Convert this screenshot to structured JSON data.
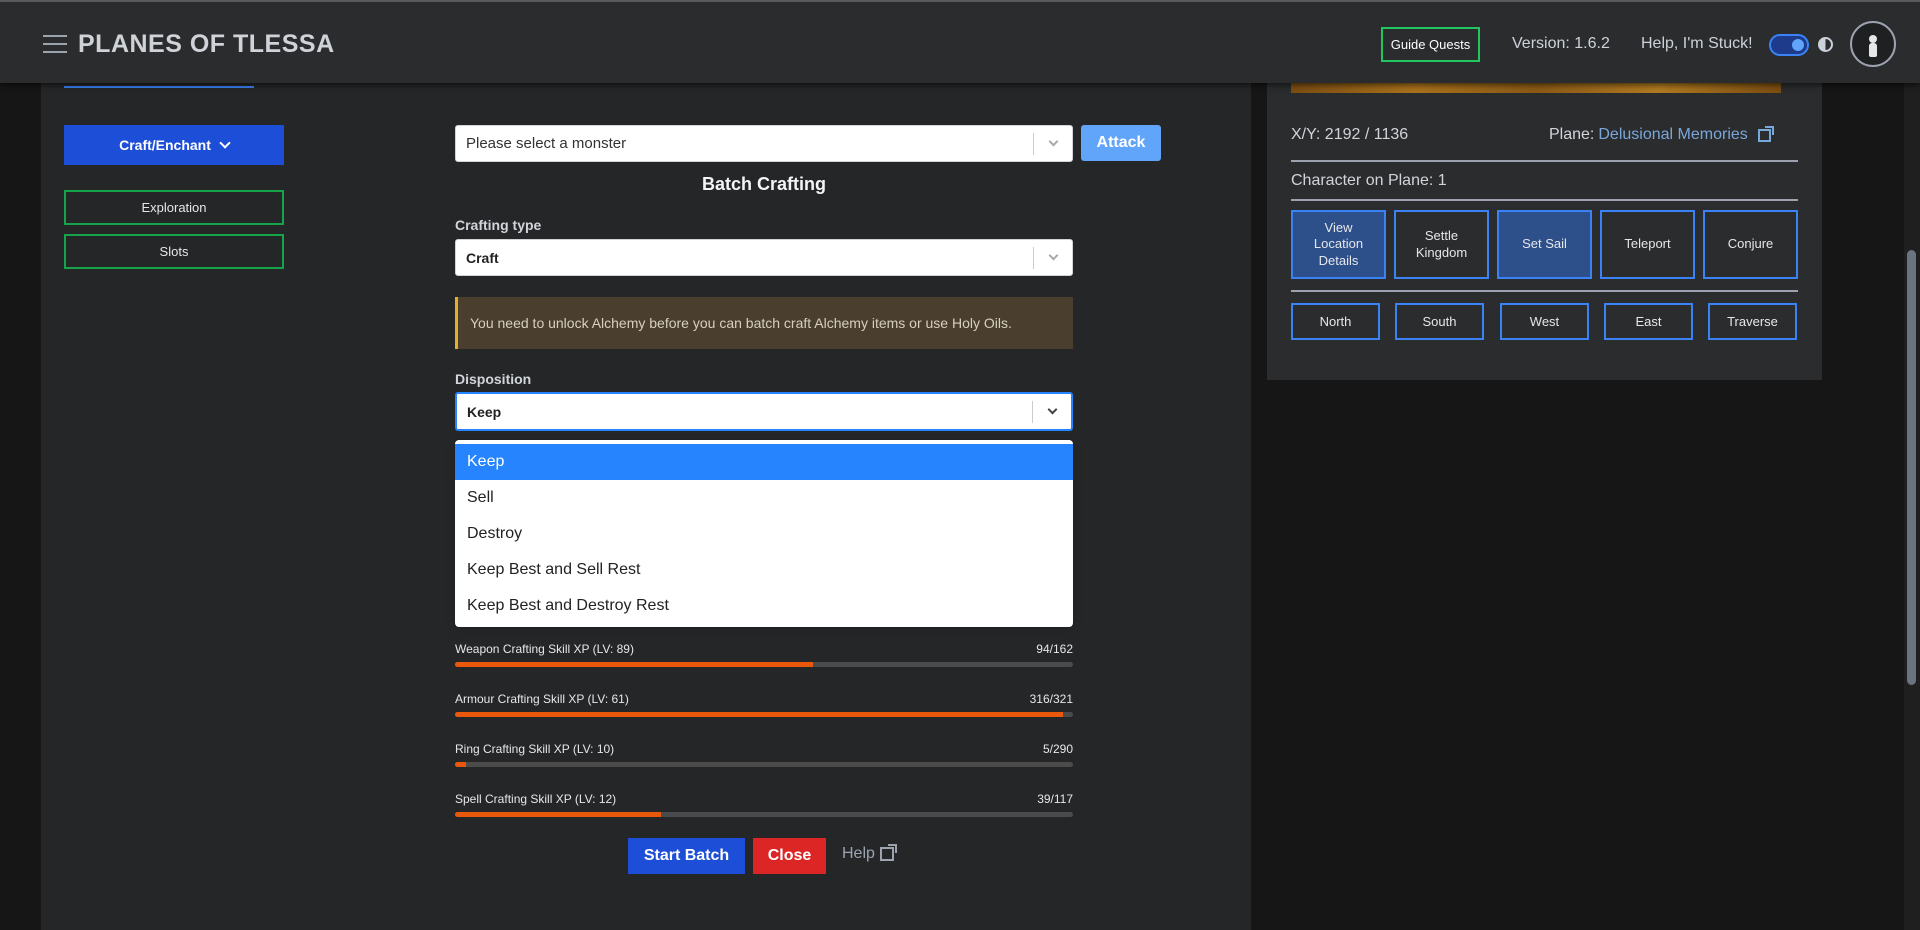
{
  "header": {
    "brand": "PLANES OF TLESSA",
    "guide_quests": "Guide Quests",
    "version": "Version: 1.6.2",
    "help_stuck": "Help, I'm Stuck!"
  },
  "sidebar": {
    "craft_enchant": "Craft/Enchant",
    "exploration": "Exploration",
    "slots": "Slots"
  },
  "monster_select": {
    "placeholder": "Please select a monster",
    "attack": "Attack"
  },
  "batch": {
    "title": "Batch Crafting",
    "crafting_type_label": "Crafting type",
    "crafting_type_value": "Craft",
    "alert": "You need to unlock Alchemy before you can batch craft Alchemy items or use Holy Oils.",
    "disposition_label": "Disposition",
    "disposition_value": "Keep",
    "options": [
      "Keep",
      "Sell",
      "Destroy",
      "Keep Best and Sell Rest",
      "Keep Best and Destroy Rest"
    ],
    "selected_option": "Keep"
  },
  "skills": [
    {
      "label": "Weapon Crafting Skill XP (LV: 89)",
      "value": "94/162",
      "fraction": 0.58
    },
    {
      "label": "Armour Crafting Skill XP (LV: 61)",
      "value": "316/321",
      "fraction": 0.984
    },
    {
      "label": "Ring Crafting Skill XP (LV: 10)",
      "value": "5/290",
      "fraction": 0.017
    },
    {
      "label": "Spell Crafting Skill XP (LV: 12)",
      "value": "39/117",
      "fraction": 0.333
    }
  ],
  "buttons": {
    "start_batch": "Start Batch",
    "close": "Close",
    "help": "Help"
  },
  "location": {
    "coords": "X/Y: 2192 / 1136",
    "plane_label": "Plane:",
    "plane_name": "Delusional Memories",
    "character_on_plane": "Character on Plane: 1",
    "actions": [
      "View Location Details",
      "Settle Kingdom",
      "Set Sail",
      "Teleport",
      "Conjure"
    ],
    "directions": [
      "North",
      "South",
      "West",
      "East",
      "Traverse"
    ]
  },
  "colors": {
    "primary": "#1d4ed8",
    "danger": "#dc2626",
    "success_outline": "#16a34a",
    "xp_bar": "#ea580c",
    "focus": "#2684ff"
  }
}
